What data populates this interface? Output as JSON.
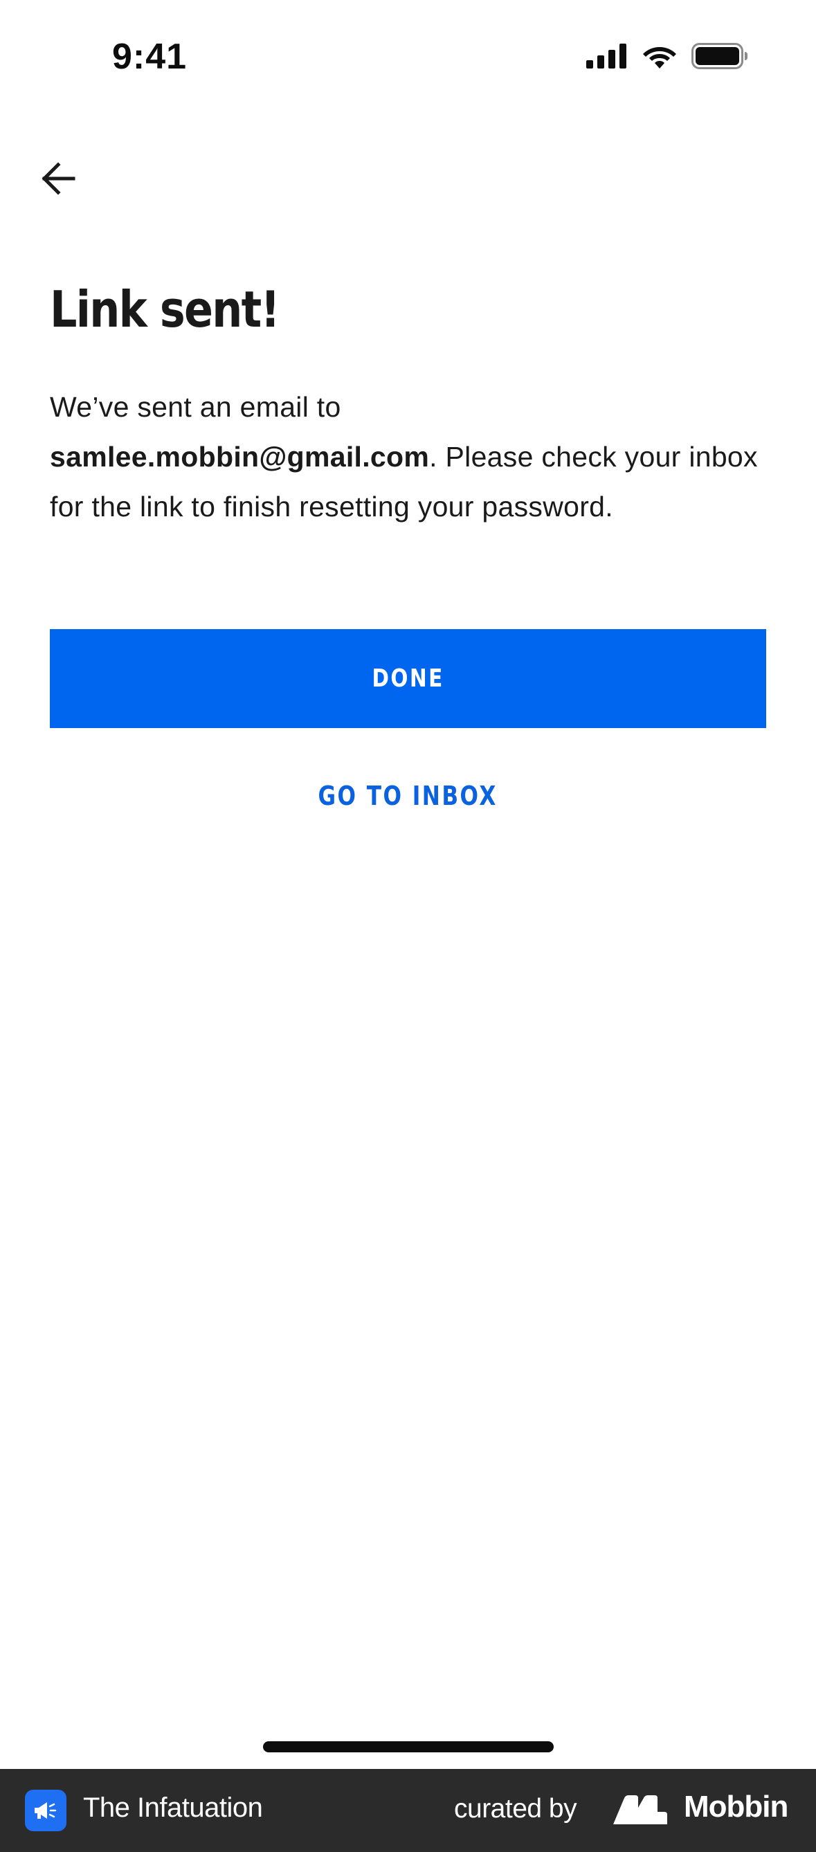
{
  "status_bar": {
    "time": "9:41",
    "icons": [
      "signal-icon",
      "wifi-icon",
      "battery-icon"
    ]
  },
  "nav": {
    "back_icon": "arrow-left-icon"
  },
  "content": {
    "title": "Link sent!",
    "message_prefix": "We’ve sent an email to",
    "email": "samlee.mobbin@gmail.com",
    "message_suffix": ". Please check your inbox for the link to finish resetting your password."
  },
  "actions": {
    "done_label": "DONE",
    "inbox_label": "GO TO INBOX"
  },
  "footer": {
    "app_name": "The Infatuation",
    "curated_label": "curated by",
    "brand_name": "Mobbin",
    "app_icon": "megaphone-icon",
    "brand_icon": "mobbin-logo-icon"
  },
  "colors": {
    "primary": "#0066f0",
    "link": "#0a62df",
    "text": "#1a1a1a",
    "footer_bg": "#2b2b2b"
  }
}
